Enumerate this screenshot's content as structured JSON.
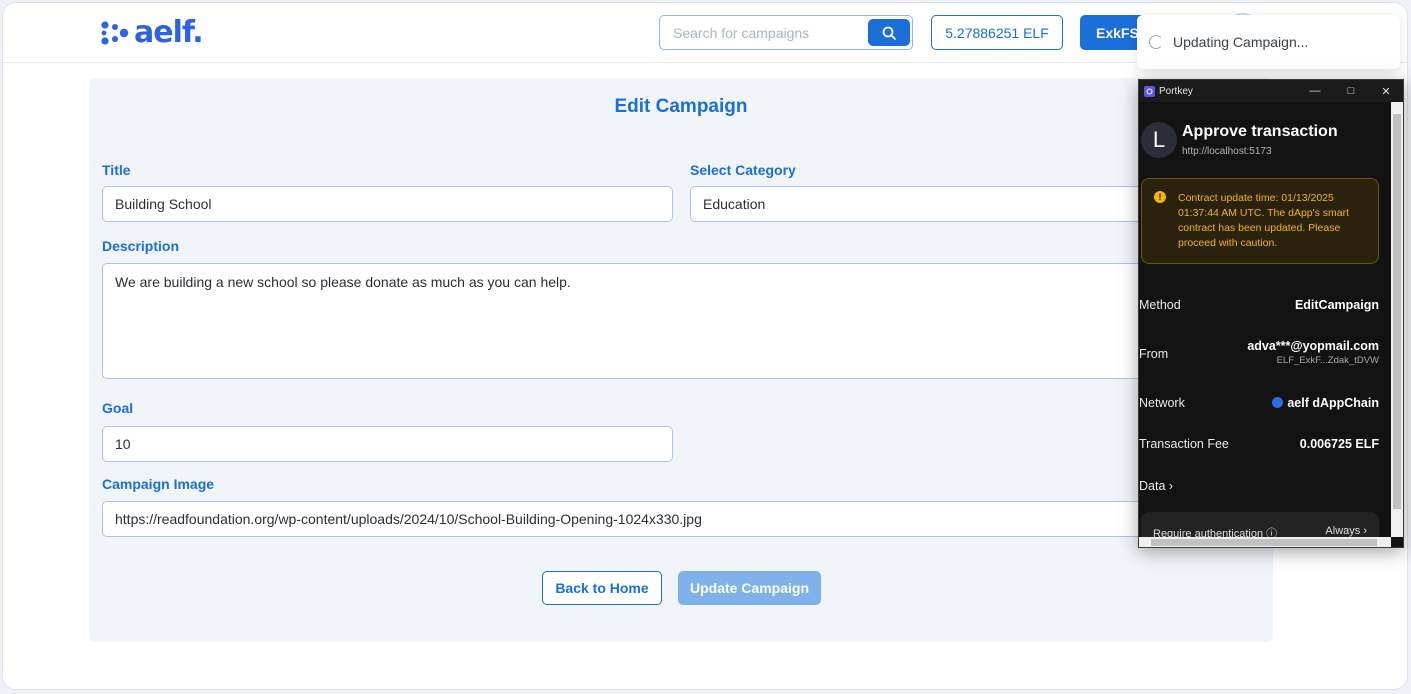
{
  "header": {
    "logo_text": "aelf.",
    "search_placeholder": "Search for campaigns",
    "balance": "5.27886251 ELF",
    "account_label": "ExkFS."
  },
  "form": {
    "title": "Edit Campaign",
    "title_label": "Title",
    "title_value": "Building School",
    "category_label": "Select Category",
    "category_value": "Education",
    "description_label": "Description",
    "description_value": "We are building a new school so please donate as much as you can help.",
    "goal_label": "Goal",
    "goal_value": "10",
    "image_label": "Campaign Image",
    "image_value": "https://readfoundation.org/wp-content/uploads/2024/10/School-Building-Opening-1024x330.jpg",
    "back_button": "Back to Home",
    "update_button": "Update Campaign"
  },
  "toast": {
    "text": "Updating Campaign..."
  },
  "portkey": {
    "window_title": "Portkey",
    "avatar_letter": "L",
    "heading": "Approve transaction",
    "url": "http://localhost:5173",
    "warning": "Contract update time: 01/13/2025 01:37:44 AM UTC. The dApp's smart contract has been updated. Please proceed with caution.",
    "method_label": "Method",
    "method_value": "EditCampaign",
    "from_label": "From",
    "from_email": "adva***@yopmail.com",
    "from_address": "ELF_ExkF...Zdak_tDVW",
    "network_label": "Network",
    "network_value": "aelf dAppChain",
    "fee_label": "Transaction Fee",
    "fee_value": "0.006725 ELF",
    "data_label": "Data",
    "auth_label": "Require authentication",
    "auth_value": "Always"
  },
  "colors": {
    "accent": "#1a6fd8",
    "warning": "#f5b40c",
    "popup_bg": "#121212"
  }
}
